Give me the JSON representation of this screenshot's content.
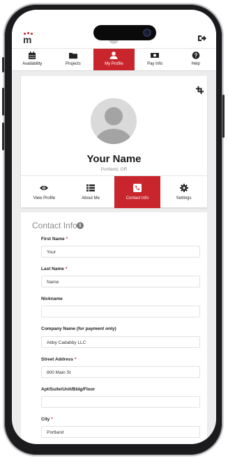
{
  "header": {
    "logo_icon": "people-logo-icon",
    "avatar_icon": "user-avatar-icon",
    "logout_icon": "sign-out-icon"
  },
  "tabs": [
    {
      "label": "Availability",
      "icon": "calendar-icon"
    },
    {
      "label": "Projects",
      "icon": "folder-icon"
    },
    {
      "label": "My Profile",
      "icon": "user-icon",
      "active": true
    },
    {
      "label": "Pay Info",
      "icon": "money-icon"
    },
    {
      "label": "Help",
      "icon": "question-icon"
    }
  ],
  "profile": {
    "name": "Your Name",
    "location": "Portland, OR",
    "crop_icon": "crop-icon"
  },
  "subtabs": [
    {
      "label": "View Profile",
      "icon": "eye-icon"
    },
    {
      "label": "About Me",
      "icon": "list-icon"
    },
    {
      "label": "Contact Info",
      "icon": "phone-icon",
      "active": true
    },
    {
      "label": "Settings",
      "icon": "gear-icon"
    }
  ],
  "contact": {
    "title": "Contact Info",
    "info_icon": "i",
    "fields": [
      {
        "label": "First Name",
        "required": "*",
        "value": "Your"
      },
      {
        "label": "Last Name",
        "required": "*",
        "value": "Name"
      },
      {
        "label": "Nickname",
        "required": "",
        "value": ""
      },
      {
        "label": "Company Name (for payment only)",
        "required": "",
        "value": "Abby Cadabby LLC"
      },
      {
        "label": "Street Address",
        "required": "*",
        "value": "800 Main St"
      },
      {
        "label": "Apt/Suite/Unit/Bldg/Floor",
        "required": "",
        "value": ""
      },
      {
        "label": "City",
        "required": "*",
        "value": "Portland"
      }
    ]
  },
  "colors": {
    "accent": "#c9252d",
    "background": "#ececec"
  }
}
